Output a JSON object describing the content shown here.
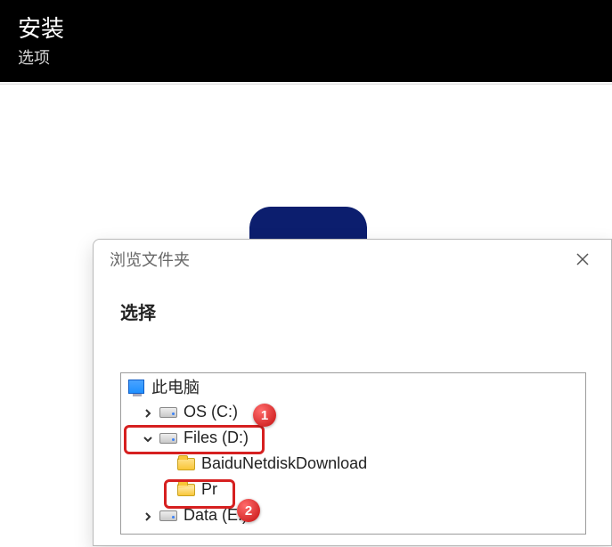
{
  "installer": {
    "title": "安装",
    "subtitle": "选项"
  },
  "dialog": {
    "title": "浏览文件夹",
    "prompt": "选择",
    "close_label": "close"
  },
  "tree": {
    "root": "此电脑",
    "drive_c": "OS (C:)",
    "drive_d": "Files (D:)",
    "folder1": "BaiduNetdiskDownload",
    "folder2": "Pr",
    "drive_e": "Data (E:)"
  },
  "annotations": {
    "marker1": "1",
    "marker2": "2"
  }
}
